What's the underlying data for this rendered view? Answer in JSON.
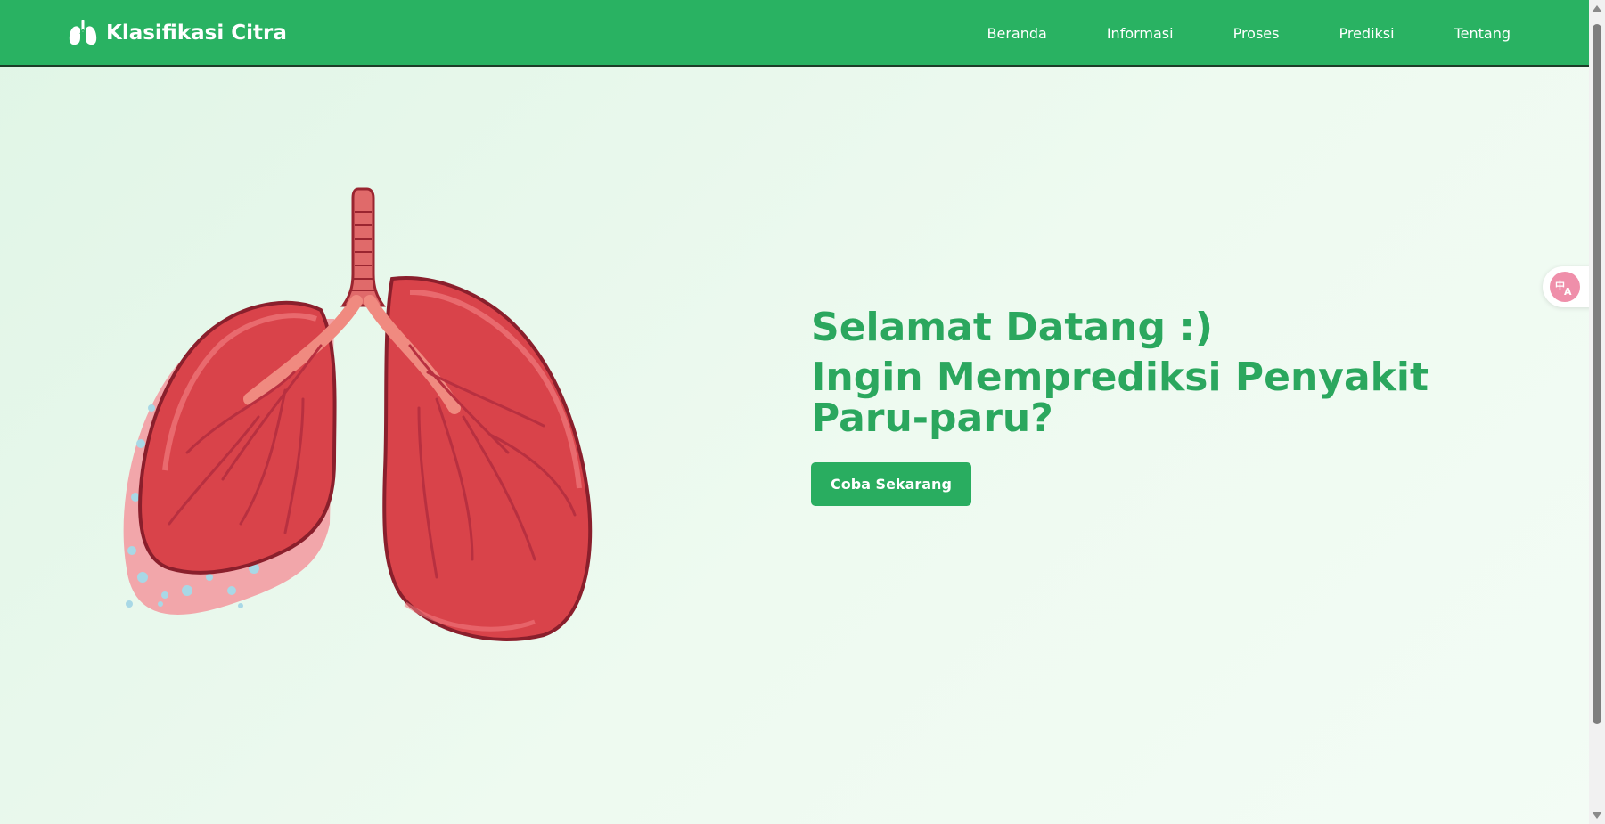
{
  "app": {
    "brand_name": "Klasifikasi Citra",
    "brand_icon": "lungs-icon"
  },
  "nav": {
    "items": [
      {
        "label": "Beranda"
      },
      {
        "label": "Informasi"
      },
      {
        "label": "Proses"
      },
      {
        "label": "Prediksi"
      },
      {
        "label": "Tentang"
      }
    ]
  },
  "hero": {
    "title": "Selamat Datang :)",
    "subtitle": "Ingin Memprediksi Penyakit Paru-paru?",
    "cta_label": "Coba Sekarang",
    "illustration": "lungs-illustration"
  },
  "widgets": {
    "translate_icon": "translate-icon"
  },
  "colors": {
    "primary": "#29b262",
    "heading": "#2ba75e",
    "background": "#e8f8ec",
    "lung_red": "#d9434a",
    "translate_pink": "#ef8faa"
  }
}
